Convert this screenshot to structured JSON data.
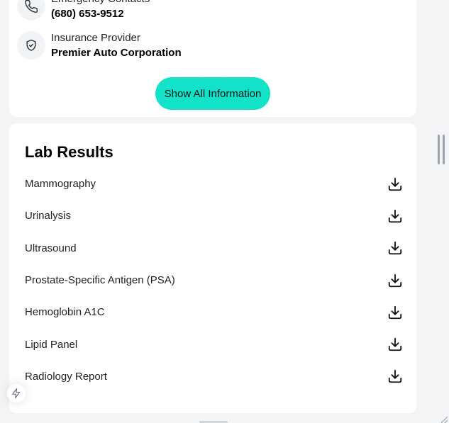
{
  "contact_card": {
    "emergency": {
      "label": "Emergency Contacts",
      "value": "(680) 653-9512",
      "icon": "phone-icon"
    },
    "insurance": {
      "label": "Insurance Provider",
      "value": "Premier Auto Corporation",
      "icon": "shield-check-icon"
    },
    "show_all_label": "Show All Information"
  },
  "lab_results": {
    "title": "Lab Results",
    "items": [
      {
        "name": "Mammography",
        "icon": "download-icon"
      },
      {
        "name": "Urinalysis",
        "icon": "download-icon"
      },
      {
        "name": "Ultrasound",
        "icon": "download-icon"
      },
      {
        "name": "Prostate-Specific Antigen (PSA)",
        "icon": "download-icon"
      },
      {
        "name": "Hemoglobin A1C",
        "icon": "download-icon"
      },
      {
        "name": "Lipid Panel",
        "icon": "download-icon"
      },
      {
        "name": "Radiology Report",
        "icon": "download-icon"
      }
    ]
  },
  "colors": {
    "accent": "#13e2c8",
    "page_background": "#f3f4f6",
    "card_background": "#ffffff",
    "icon_circle": "#f1f3f5"
  },
  "floating": {
    "icon": "zap-icon"
  }
}
